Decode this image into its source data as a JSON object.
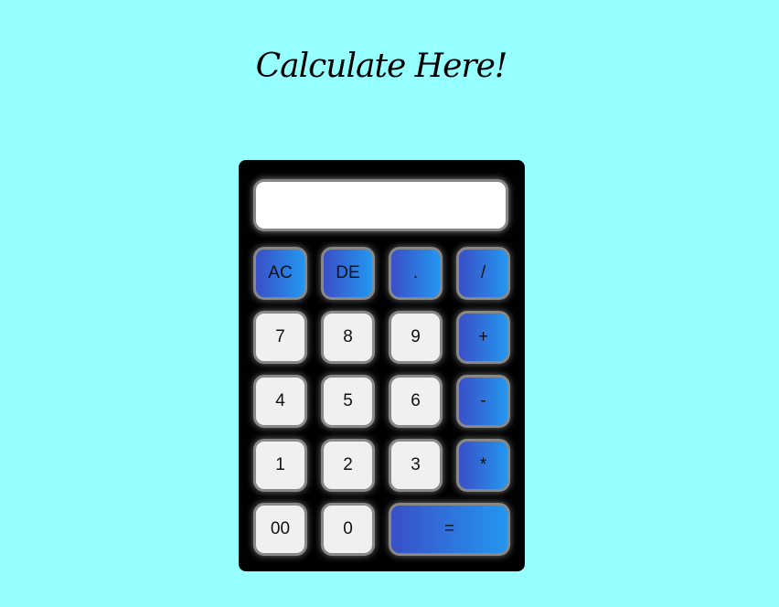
{
  "page": {
    "title": "Calculate Here!"
  },
  "display": {
    "value": ""
  },
  "keys": {
    "ac": "AC",
    "de": "DE",
    "dot": ".",
    "divide": "/",
    "seven": "7",
    "eight": "8",
    "nine": "9",
    "plus": "+",
    "four": "4",
    "five": "5",
    "six": "6",
    "minus": "-",
    "one": "1",
    "two": "2",
    "three": "3",
    "multiply": "*",
    "double_zero": "00",
    "zero": "0",
    "equals": "="
  },
  "colors": {
    "page_background": "#96ffff",
    "calculator_body": "#000000",
    "display_background": "#ffffff",
    "light_key": "#f0f0f0",
    "operator_gradient_start": "#3a4fc7",
    "operator_gradient_end": "#2397ef",
    "key_border": "#888888"
  }
}
